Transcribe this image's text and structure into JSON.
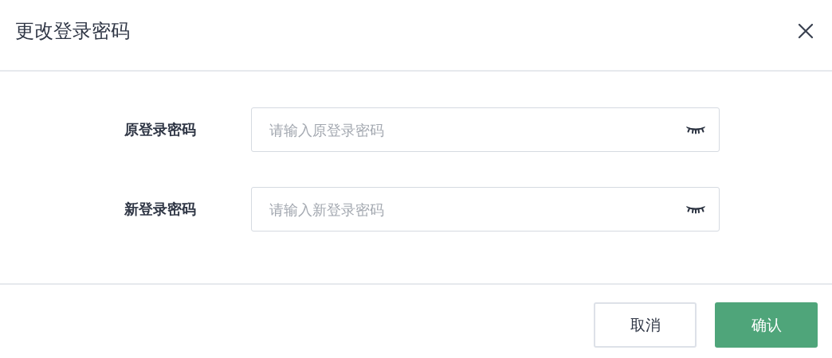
{
  "dialog": {
    "title": "更改登录密码"
  },
  "fields": [
    {
      "label": "原登录密码",
      "placeholder": "请输入原登录密码"
    },
    {
      "label": "新登录密码",
      "placeholder": "请输入新登录密码"
    }
  ],
  "buttons": [
    {
      "label": "取消",
      "kind": "secondary"
    },
    {
      "label": "确认",
      "kind": "primary"
    }
  ]
}
